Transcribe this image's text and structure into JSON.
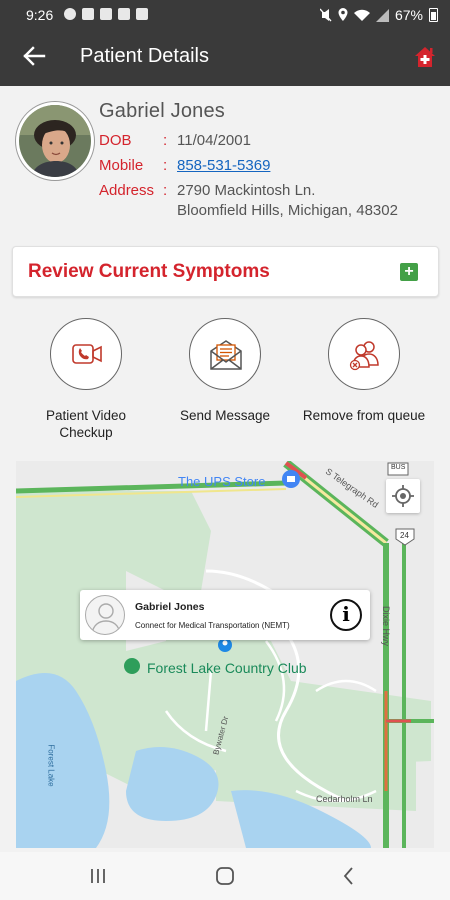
{
  "status_bar": {
    "time": "9:26",
    "battery": "67%"
  },
  "app_bar": {
    "title": "Patient Details"
  },
  "patient": {
    "name": "Gabriel  Jones",
    "dob_label": "DOB",
    "dob": "11/04/2001",
    "mobile_label": "Mobile",
    "mobile": "858-531-5369",
    "address_label": "Address",
    "address_line1": "2790 Mackintosh Ln.",
    "address_line2": "Bloomfield Hills, Michigan, 48302",
    "separator": ":"
  },
  "review": {
    "label": "Review Current Symptoms"
  },
  "actions": [
    {
      "label": "Patient Video\nCheckup",
      "icon": "video-call-icon"
    },
    {
      "label": "Send Message",
      "icon": "envelope-icon"
    },
    {
      "label": "Remove from queue",
      "icon": "remove-user-icon"
    }
  ],
  "map": {
    "place_ups": "The UPS Store",
    "place_forest": "Forest Lake Country Club",
    "road_telegraph": "S Telegraph Rd",
    "road_dixie": "Dixie Hwy",
    "road_cedarholm": "Cedarholm Ln",
    "road_bywater": "Bywater Dr",
    "lake_label": "Forest Lake",
    "route_shield": "24",
    "highway_shield": "BUS",
    "info_name": "Gabriel  Jones",
    "info_subtitle": "Connect for Medical Transportation (NEMT)"
  },
  "colors": {
    "accent_red": "#d4242d",
    "app_bar": "#3a3a3a",
    "plus_green": "#43a047",
    "link_blue": "#1565c0"
  }
}
